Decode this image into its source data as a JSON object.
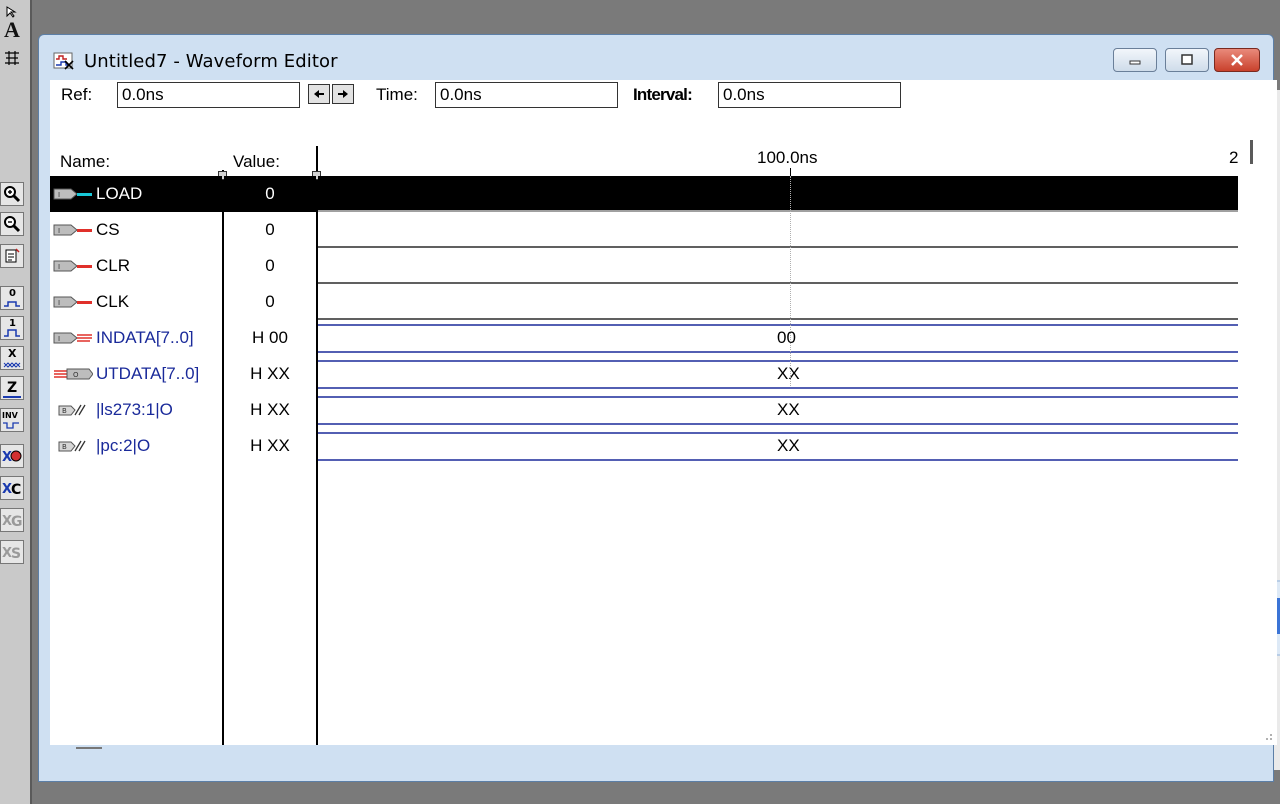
{
  "window": {
    "title": "Untitled7 - Waveform Editor"
  },
  "toolbar": {
    "ref_label": "Ref:",
    "ref_value": "0.0ns",
    "time_label": "Time:",
    "time_value": "0.0ns",
    "interval_label": "Interval:",
    "interval_value": "0.0ns"
  },
  "header": {
    "name_label": "Name:",
    "value_label": "Value:",
    "time_tick_1": "100.0ns",
    "time_tick_2": "2"
  },
  "signals": [
    {
      "name": "LOAD",
      "value": "0",
      "type": "input",
      "wave_label": ""
    },
    {
      "name": "CS",
      "value": "0",
      "type": "input",
      "wave_label": ""
    },
    {
      "name": "CLR",
      "value": "0",
      "type": "input",
      "wave_label": ""
    },
    {
      "name": "CLK",
      "value": "0",
      "type": "input",
      "wave_label": ""
    },
    {
      "name": "INDATA[7..0]",
      "value": "H 00",
      "type": "input-bus",
      "wave_label": "00"
    },
    {
      "name": "UTDATA[7..0]",
      "value": "H XX",
      "type": "output-bus",
      "wave_label": "XX"
    },
    {
      "name": "|ls273:1|O",
      "value": "H XX",
      "type": "buried",
      "wave_label": "XX"
    },
    {
      "name": "|pc:2|O",
      "value": "H XX",
      "type": "buried",
      "wave_label": "XX"
    }
  ],
  "palette": [
    {
      "name": "pointer-tool-icon",
      "glyph": "↖"
    },
    {
      "name": "text-tool-icon",
      "glyph": "A"
    },
    {
      "name": "node-tool-icon",
      "glyph": "⌘"
    },
    {
      "name": "zoom-in-icon",
      "glyph": "⊕"
    },
    {
      "name": "zoom-out-icon",
      "glyph": "⊖"
    },
    {
      "name": "fit-window-icon",
      "glyph": "▤"
    },
    {
      "name": "set-low-icon",
      "glyph": "0"
    },
    {
      "name": "set-high-icon",
      "glyph": "1"
    },
    {
      "name": "set-unknown-icon",
      "glyph": "X"
    },
    {
      "name": "set-highz-icon",
      "glyph": "Z"
    },
    {
      "name": "invert-icon",
      "glyph": "INV"
    },
    {
      "name": "overwrite-count-icon",
      "glyph": "XO"
    },
    {
      "name": "overwrite-clock-icon",
      "glyph": "XC"
    },
    {
      "name": "overwrite-group-icon",
      "glyph": "XG"
    },
    {
      "name": "overwrite-sequence-icon",
      "glyph": "XS"
    }
  ],
  "colors": {
    "input_arrow": "#e0302a",
    "selected_arrow": "#18c8d8",
    "bus_line": "#1a2a9a",
    "title_bar": "#cfe0f2"
  }
}
